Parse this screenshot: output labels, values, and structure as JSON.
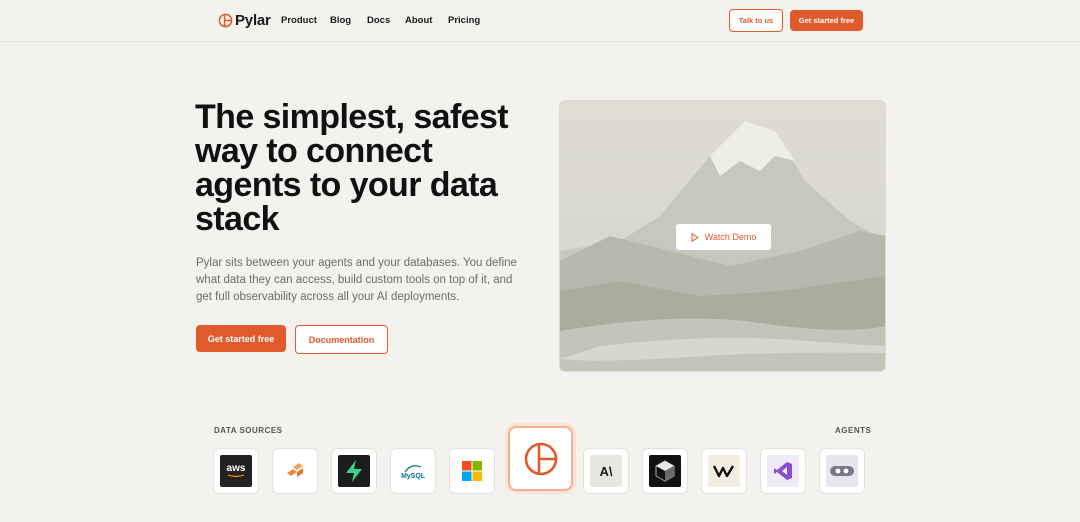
{
  "nav": {
    "brand": "Pylar",
    "links": [
      "Product",
      "Blog",
      "Docs",
      "About",
      "Pricing"
    ],
    "talk_label": "Talk to us",
    "start_label": "Get started free"
  },
  "hero": {
    "title": "The simplest, safest way to connect agents to your data stack",
    "subtitle": "Pylar sits between your agents and your databases. You define what data they can access, build custom tools on top of it, and get full observability across all your AI deployments.",
    "primary_cta": "Get started free",
    "secondary_cta": "Documentation"
  },
  "video": {
    "watch_label": "Watch Demo"
  },
  "integrations": {
    "sources_label": "DATA SOURCES",
    "agents_label": "AGENTS",
    "sources": [
      {
        "name": "aws",
        "text": "aws"
      },
      {
        "name": "databricks"
      },
      {
        "name": "supabase"
      },
      {
        "name": "mysql",
        "text": "MySQL"
      },
      {
        "name": "microsoft"
      }
    ],
    "agents": [
      {
        "name": "anthropic",
        "text": "A\\"
      },
      {
        "name": "cursor"
      },
      {
        "name": "windsurf"
      },
      {
        "name": "visual-studio"
      },
      {
        "name": "n8n"
      }
    ]
  },
  "colors": {
    "accent": "#e05a2b",
    "background": "#f3f2ef"
  }
}
